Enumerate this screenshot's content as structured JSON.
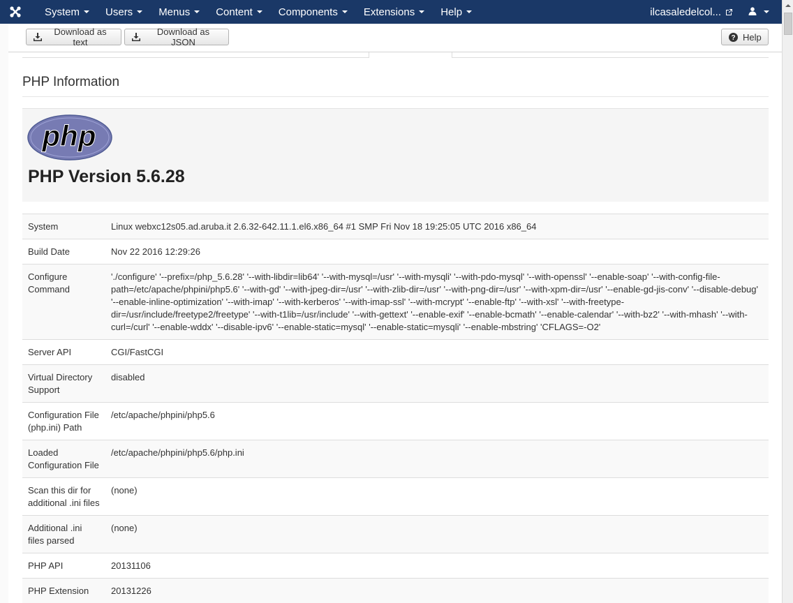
{
  "navbar": {
    "menu": [
      "System",
      "Users",
      "Menus",
      "Content",
      "Components",
      "Extensions",
      "Help"
    ],
    "site_name": "ilcasaledelcol..."
  },
  "toolbar": {
    "download_text": "Download as text",
    "download_json": "Download as JSON",
    "help": "Help"
  },
  "page": {
    "title": "PHP Information",
    "logo_text": "php",
    "version": "PHP Version 5.6.28"
  },
  "rows": [
    {
      "key": "System",
      "value": "Linux webxc12s05.ad.aruba.it 2.6.32-642.11.1.el6.x86_64 #1 SMP Fri Nov 18 19:25:05 UTC 2016 x86_64"
    },
    {
      "key": "Build Date",
      "value": "Nov 22 2016 12:29:26"
    },
    {
      "key": "Configure Command",
      "value": "'./configure' '--prefix=/php_5.6.28' '--with-libdir=lib64' '--with-mysql=/usr' '--with-mysqli' '--with-pdo-mysql' '--with-openssl' '--enable-soap' '--with-config-file-path=/etc/apache/phpini/php5.6' '--with-gd' '--with-jpeg-dir=/usr' '--with-zlib-dir=/usr' '--with-png-dir=/usr' '--with-xpm-dir=/usr' '--enable-gd-jis-conv' '--disable-debug' '--enable-inline-optimization' '--with-imap' '--with-kerberos' '--with-imap-ssl' '--with-mcrypt' '--enable-ftp' '--with-xsl' '--with-freetype-dir=/usr/include/freetype2/freetype' '--with-t1lib=/usr/include' '--with-gettext' '--enable-exif' '--enable-bcmath' '--enable-calendar' '--with-bz2' '--with-mhash' '--with-curl=/curl' '--enable-wddx' '--disable-ipv6' '--enable-static=mysql' '--enable-static=mysqli' '--enable-mbstring' 'CFLAGS=-O2'"
    },
    {
      "key": "Server API",
      "value": "CGI/FastCGI"
    },
    {
      "key": "Virtual Directory Support",
      "value": "disabled"
    },
    {
      "key": "Configuration File (php.ini) Path",
      "value": "/etc/apache/phpini/php5.6"
    },
    {
      "key": "Loaded Configuration File",
      "value": "/etc/apache/phpini/php5.6/php.ini"
    },
    {
      "key": "Scan this dir for additional .ini files",
      "value": "(none)"
    },
    {
      "key": "Additional .ini files parsed",
      "value": "(none)"
    },
    {
      "key": "PHP API",
      "value": "20131106"
    },
    {
      "key": "PHP Extension",
      "value": "20131226"
    }
  ],
  "colors": {
    "navbar": "#1a3867",
    "php_logo": "#777bb3"
  }
}
